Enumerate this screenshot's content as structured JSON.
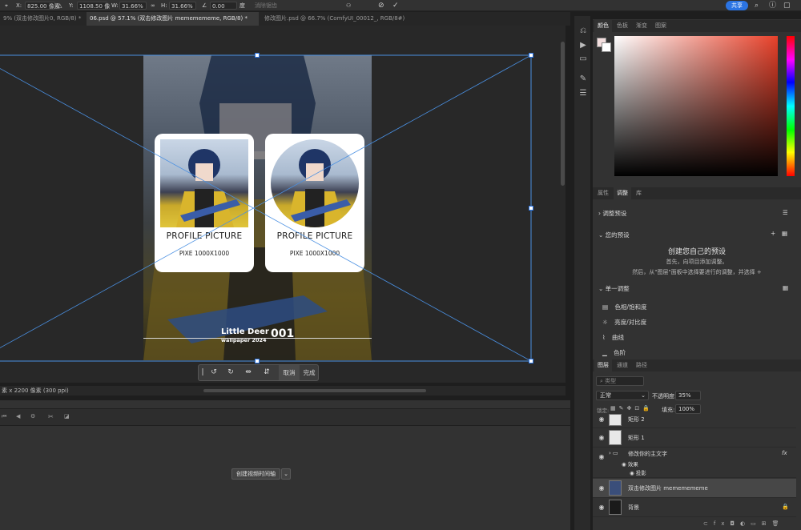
{
  "options_bar": {
    "x_label": "X:",
    "x_value": "825.00 像素",
    "y_label": "Y:",
    "y_value": "1108.50 像",
    "w_label": "W:",
    "w_value": "31.66%",
    "h_label": "H:",
    "h_value": "31.66%",
    "angle_value": "0.00",
    "angle_unit": "度",
    "interp_label": "消除锯齿",
    "share_label": "共享"
  },
  "tabs": [
    {
      "label": "9% (双击修改图片0, RGB/8) *"
    },
    {
      "label": "06.psd @ 57.1% (双击修改图片 mememememe, RGB/8) *"
    },
    {
      "label": "修改图片.psd @ 66.7% (ComfyUI_00012_, RGB/8#)"
    }
  ],
  "artwork": {
    "card1_title": "PROFILE PICTURE",
    "card1_sub": "PIXE 1000X1000",
    "card2_title": "PROFILE PICTURE",
    "card2_sub": "PIXE 1000X1000",
    "brand_line1": "Little Deer",
    "brand_line2": "wallpaper 2024",
    "brand_number": "001"
  },
  "context_bar": {
    "cancel": "取消",
    "done": "完成"
  },
  "status": {
    "text": "素 x 2200 像素 (300 ppi)"
  },
  "timeline": {
    "create_button": "创建视频时间轴"
  },
  "color_panel": {
    "tabs": [
      "颜色",
      "色板",
      "渐变",
      "图案"
    ],
    "active": "颜色"
  },
  "adjust_panel": {
    "tabs": [
      "属性",
      "调整",
      "库"
    ],
    "active": "调整",
    "presets_label": "调整预设",
    "your_presets": "您的预设",
    "create_title": "创建您自己的预设",
    "create_line1": "首先，向项目添加调整。",
    "create_line2": "然后，从\"图层\"面板中选择要进行的调整，并选择",
    "single_adjust": "单一调整",
    "items": [
      "色相/饱和度",
      "亮度/对比度",
      "曲线",
      "色阶"
    ]
  },
  "layers_panel": {
    "tabs": [
      "图层",
      "通道",
      "路径"
    ],
    "active": "图层",
    "search_placeholder": "类型",
    "blend_mode": "正常",
    "opacity_label": "不透明度:",
    "opacity_value": "35%",
    "lock_label": "锁定:",
    "fill_label": "填充:",
    "fill_value": "100%",
    "layers": [
      {
        "name": "矩形 2"
      },
      {
        "name": "矩形 1"
      },
      {
        "name": "修改你的主文字"
      },
      {
        "name": "效果"
      },
      {
        "name": "投影"
      },
      {
        "name": "双击修改图片 mememememe"
      },
      {
        "name": "背景"
      }
    ],
    "fx_label": "fx"
  }
}
